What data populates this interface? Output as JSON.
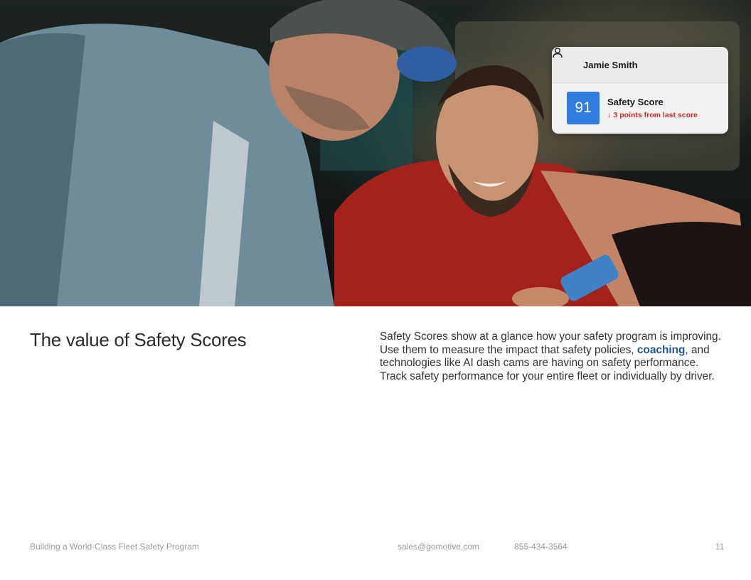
{
  "profile_card": {
    "user_name": "Jamie Smith",
    "score_value": "91",
    "score_label": "Safety Score",
    "score_change": "3 points from last score",
    "score_color": "#2f7dde",
    "change_color": "#c8312a",
    "icons": {
      "user": "user-icon",
      "change": "arrow-down-icon"
    }
  },
  "content": {
    "heading": "The value of Safety Scores",
    "paragraph_before": "Safety Scores show at a glance how your safety program is improving. Use them to measure the impact that safety policies, ",
    "paragraph_link": "coaching",
    "paragraph_after": ", and technologies like AI dash cams are having on safety performance. Track safety performance for your entire fleet or individually by driver.",
    "link_color": "#1f5a8f"
  },
  "footer": {
    "document_title": "Building a World-Class Fleet Safety Program",
    "email": "sales@gomotive.com",
    "phone": "855-434-3564",
    "page_number": "11"
  }
}
